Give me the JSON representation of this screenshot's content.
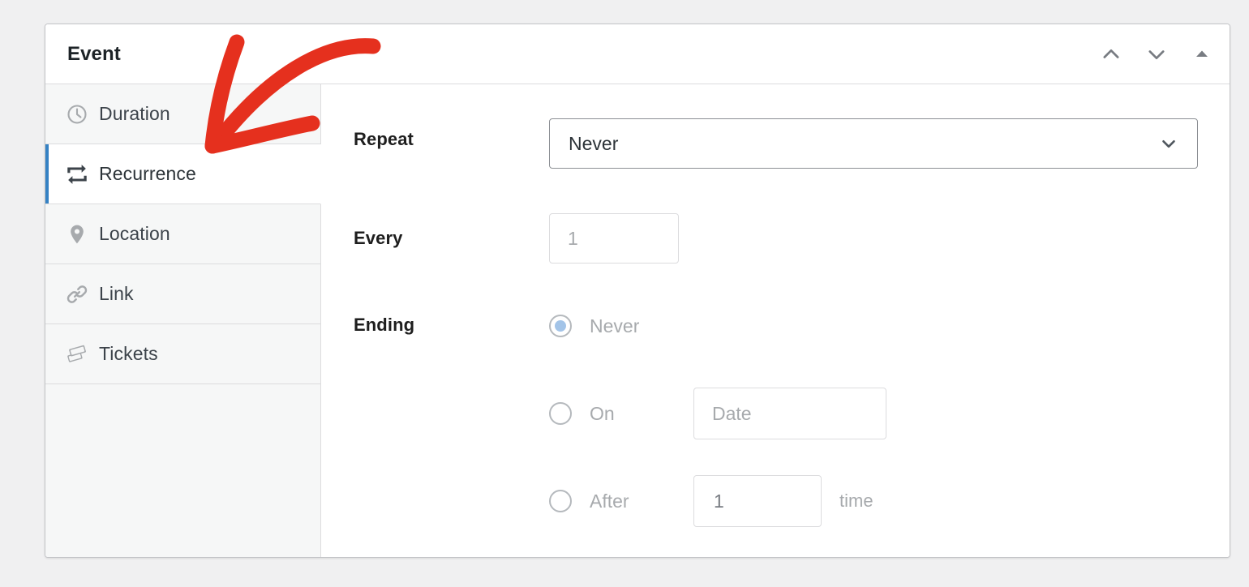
{
  "panel": {
    "title": "Event",
    "header_actions": [
      {
        "name": "move-up-icon",
        "label": "Move up"
      },
      {
        "name": "move-down-icon",
        "label": "Move down"
      },
      {
        "name": "collapse-icon",
        "label": "Collapse"
      }
    ]
  },
  "tabs": [
    {
      "label": "Duration",
      "icon": "clock-icon",
      "active": false
    },
    {
      "label": "Recurrence",
      "icon": "recurrence-icon",
      "active": true
    },
    {
      "label": "Location",
      "icon": "map-pin-icon",
      "active": false
    },
    {
      "label": "Link",
      "icon": "link-icon",
      "active": false
    },
    {
      "label": "Tickets",
      "icon": "tickets-icon",
      "active": false
    }
  ],
  "form": {
    "repeat": {
      "label": "Repeat",
      "value": "Never"
    },
    "every": {
      "label": "Every",
      "value": "1"
    },
    "ending": {
      "label": "Ending",
      "options": [
        {
          "label": "Never",
          "selected": true
        },
        {
          "label": "On",
          "selected": false,
          "input_placeholder": "Date"
        },
        {
          "label": "After",
          "selected": false,
          "input_value": "1",
          "suffix": "time"
        }
      ]
    }
  },
  "colors": {
    "accent_blue": "#3582c4",
    "annotation_red": "#e5301e",
    "sidebar_bg": "#f6f7f7",
    "page_bg": "#f0f0f1",
    "border": "#dcdcde",
    "text_dark": "#1e1e1e",
    "text_muted": "#a7aaad"
  }
}
